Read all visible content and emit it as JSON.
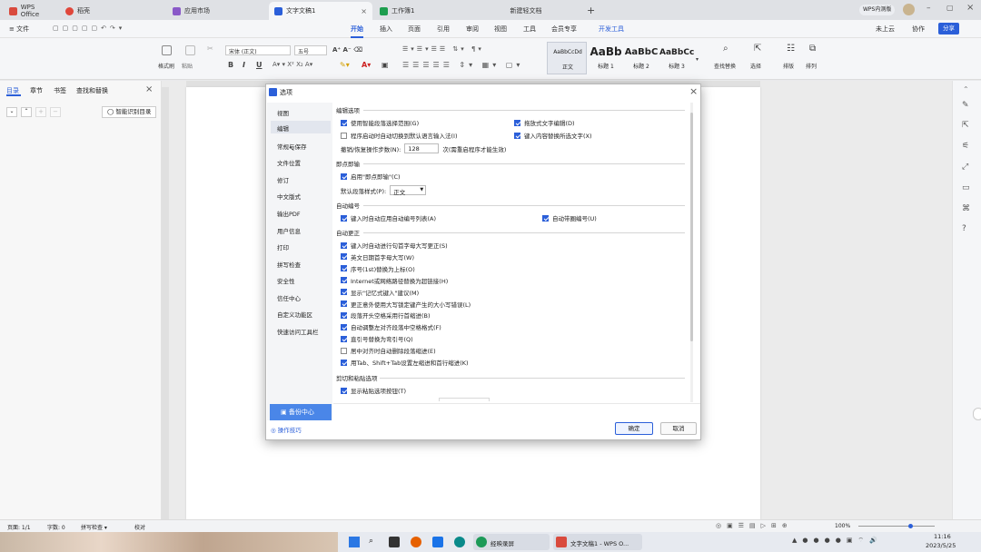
{
  "tabs": [
    {
      "label": "WPS Office",
      "color": "#d94a3d"
    },
    {
      "label": "稻壳",
      "color": "#e0473b"
    },
    {
      "label": "应用市场",
      "color": "#8a59c8"
    },
    {
      "label": "文字文稿1",
      "color": "#2b5fd9",
      "active": true
    },
    {
      "label": "工作簿1",
      "color": "#1e9e4f"
    },
    {
      "label": "新建轻文档",
      "color": ""
    }
  ],
  "window": {
    "account": "WPS内测版",
    "new_tab": "+"
  },
  "menubar": {
    "file": "≡ 文件",
    "items": [
      "开始",
      "插入",
      "页面",
      "引用",
      "审阅",
      "视图",
      "工具",
      "会员专享",
      "开发工具"
    ],
    "active": "开始",
    "right": [
      "未上云",
      "协作",
      "分享"
    ]
  },
  "ribbon": {
    "format_painter": "格式刷",
    "paste": "粘贴",
    "font_name": "宋体 (正文)",
    "font_size": "五号",
    "bold": "B",
    "italic": "I",
    "underline": "U",
    "styles": [
      {
        "preview": "AaBbCcDd",
        "name": "正文"
      },
      {
        "preview": "AaBb",
        "name": "标题 1"
      },
      {
        "preview": "AaBbC",
        "name": "标题 2"
      },
      {
        "preview": "AaBbCc",
        "name": "标题 3"
      }
    ],
    "find_replace": "查找替换",
    "select": "选择",
    "layout": "排版",
    "arrange": "排列"
  },
  "navpanel": {
    "tabs": [
      "目录",
      "章节",
      "书签",
      "查找和替换"
    ],
    "smart_toc": "智能识别目录"
  },
  "dialog": {
    "title": "选项",
    "nav": [
      "视图",
      "编辑",
      "常规与保存",
      "文件位置",
      "修订",
      "中文版式",
      "输出PDF",
      "用户信息",
      "打印",
      "拼写检查",
      "安全性",
      "信任中心",
      "自定义功能区",
      "快速访问工具栏"
    ],
    "nav_selected": "编辑",
    "backup": "备份中心",
    "tips": "操作技巧",
    "ok": "确定",
    "cancel": "取消",
    "sections": {
      "edit": {
        "title": "编辑选项",
        "opt1": "使用智能段落选择范围(G)",
        "opt2": "拖放式文字编辑(D)",
        "opt3": "程序启动时自动切换到默认语言输入法(I)",
        "opt4": "键入内容替换所选文字(X)",
        "undo_label": "撤销/恢复操作步数(N):",
        "undo_value": "128",
        "undo_note": "次(需重启程序才能生效)"
      },
      "instant": {
        "title": "即点即输",
        "opt1": "启用\"即点即输\"(C)",
        "style_label": "默认段落样式(P):",
        "style_value": "正文"
      },
      "numbering": {
        "title": "自动编号",
        "opt1": "键入时自动应用自动编号列表(A)",
        "opt2": "自动带圈编号(U)"
      },
      "correct": {
        "title": "自动更正",
        "items": [
          {
            "label": "键入时自动进行句首字母大写更正(S)",
            "on": true
          },
          {
            "label": "英文日期首字母大写(W)",
            "on": true
          },
          {
            "label": "序号(1st)替换为上标(O)",
            "on": true
          },
          {
            "label": "Internet或网络路径替换为超链接(H)",
            "on": true
          },
          {
            "label": "显示\"记忆式键入\"建议(M)",
            "on": true
          },
          {
            "label": "更正意外使用大写锁定键产生的大小写错误(L)",
            "on": true
          },
          {
            "label": "段落开头空格采用行首缩进(B)",
            "on": true
          },
          {
            "label": "自动调整左对齐段落中空格格式(F)",
            "on": true
          },
          {
            "label": "直引号替换为弯引号(Q)",
            "on": true
          },
          {
            "label": "居中对齐时自动删除段落缩进(E)",
            "on": false
          },
          {
            "label": "用Tab、Shift+Tab设置左缩进和首行缩进(K)",
            "on": true
          }
        ]
      },
      "paste": {
        "title": "剪切和粘贴选项",
        "opt1": "显示粘贴选项按钮(T)"
      }
    }
  },
  "status": {
    "page": "页面: 1/1",
    "words": "字数: 0",
    "spell": "拼写检查 ▾",
    "proof": "校对",
    "zoom": "100%"
  },
  "taskbar": {
    "apps": [
      "经映录屏",
      "文字文稿1 - WPS O..."
    ],
    "time": "11:16",
    "date": "2023/5/25"
  }
}
